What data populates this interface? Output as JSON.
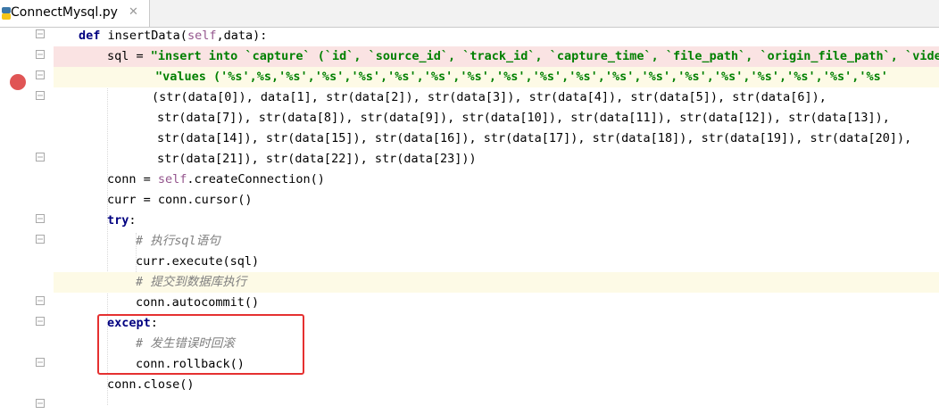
{
  "tab": {
    "filename": "ConnectMysql.py",
    "close": "✕"
  },
  "code": {
    "l1": {
      "kw": "def",
      "name": " insertData(",
      "self": "self",
      "rest": ",data):"
    },
    "l2": {
      "a": "sql = ",
      "s": "\"insert into `capture` (`id`, `source_id`, `track_id`, `capture_time`, `file_path`, `origin_file_path`, `vide"
    },
    "l3": {
      "s": "\"values ('%s',%s,'%s','%s','%s','%s','%s','%s','%s','%s','%s','%s','%s','%s','%s','%s','%s','%s','%s'"
    },
    "l4": "(str(data[0]), data[1], str(data[2]), str(data[3]), str(data[4]), str(data[5]), str(data[6]),",
    "l5": "str(data[7]), str(data[8]), str(data[9]), str(data[10]), str(data[11]), str(data[12]), str(data[13]),",
    "l6": "str(data[14]), str(data[15]), str(data[16]), str(data[17]), str(data[18]), str(data[19]), str(data[20]),",
    "l7": "str(data[21]), str(data[22]), str(data[23]))",
    "l8": {
      "a": "conn = ",
      "self": "self",
      "b": ".createConnection()"
    },
    "l9": "curr = conn.cursor()",
    "l10": {
      "kw": "try",
      "b": ":"
    },
    "l11": "# 执行sql语句",
    "l12": "curr.execute(sql)",
    "l13": "# 提交到数据库执行",
    "l14": "conn.autocommit()",
    "l15": {
      "kw": "except",
      "b": ":"
    },
    "l16": "# 发生错误时回滚",
    "l17": "conn.rollback()",
    "l18": "conn.close()"
  },
  "colors": {
    "keyword": "#000080",
    "string": "#008000",
    "self": "#94558d",
    "comment": "#808080",
    "breakpoint": "#e05555",
    "annotation_box": "#e53030"
  },
  "icons": [
    "python-file-icon",
    "close-icon",
    "breakpoint-icon",
    "fold-marker-icon"
  ]
}
